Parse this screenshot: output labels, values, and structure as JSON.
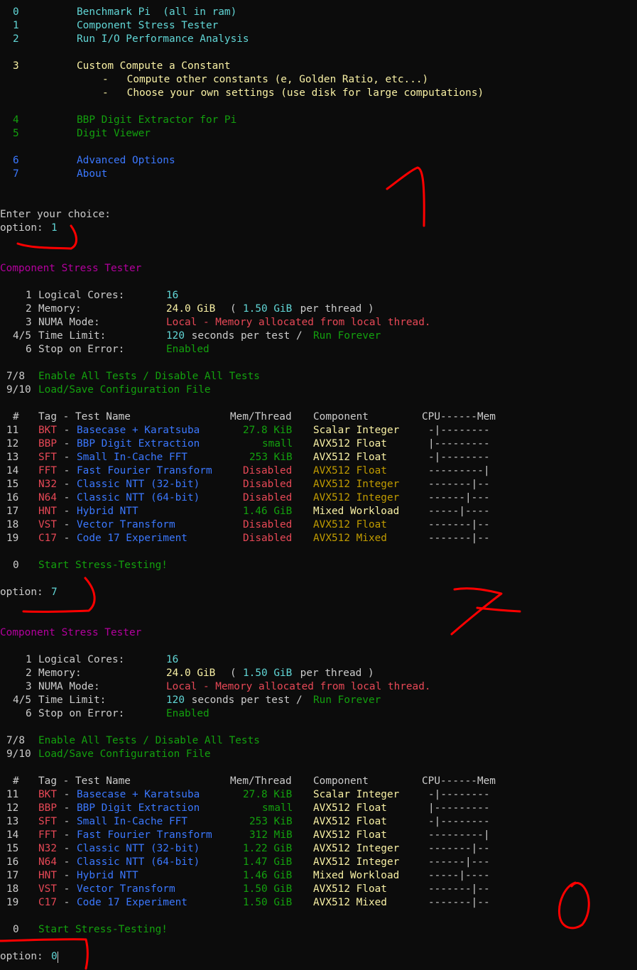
{
  "theme": {
    "bg": "#0c0c0c",
    "white": "#cccccc",
    "cyan": "#61d6d6",
    "yellow": "#f9f1a5",
    "green": "#13a10e",
    "blue": "#3b78ff",
    "magenta": "#b4009e",
    "red": "#e74856",
    "olive": "#c19c00",
    "ink": "#ff0000"
  },
  "main_menu": [
    {
      "num": "0",
      "label": "Benchmark Pi  (all in ram)",
      "color": "cyan"
    },
    {
      "num": "1",
      "label": "Component Stress Tester",
      "color": "cyan"
    },
    {
      "num": "2",
      "label": "Run I/O Performance Analysis",
      "color": "cyan"
    },
    {
      "num": "3",
      "label": "Custom Compute a Constant",
      "color": "yellow"
    },
    {
      "num": "4",
      "label": "BBP Digit Extractor for Pi",
      "color": "green"
    },
    {
      "num": "5",
      "label": "Digit Viewer",
      "color": "green"
    },
    {
      "num": "6",
      "label": "Advanced Options",
      "color": "blue"
    },
    {
      "num": "7",
      "label": "About",
      "color": "blue"
    }
  ],
  "custom_sub": [
    "-   Compute other constants (e, Golden Ratio, etc...)",
    "-   Choose your own settings (use disk for large computations)"
  ],
  "prompt": {
    "enter": "Enter your choice:",
    "option": "option: "
  },
  "inputs": [
    "1",
    "7",
    "0"
  ],
  "stress": {
    "title": "Component Stress Tester",
    "settings": [
      {
        "num": "1",
        "label": "Logical Cores:"
      },
      {
        "num": "2",
        "label": "Memory:"
      },
      {
        "num": "3",
        "label": "NUMA Mode:"
      },
      {
        "num": "4/5",
        "label": "Time Limit:"
      },
      {
        "num": "6",
        "label": "Stop on Error:"
      }
    ],
    "cores": "16",
    "mem_total": "24.0 GiB",
    "paren_open": "( ",
    "mem_thread": "1.50 GiB",
    "per_thread": " per thread )",
    "numa": "Local - Memory allocated from local thread.",
    "time_value": "120",
    "time_rest": " seconds per test / ",
    "run_forever": "Run Forever",
    "stop_value": "Enabled",
    "toggle_num": "7/8",
    "toggle_label": "Enable All Tests / Disable All Tests",
    "config_num": "9/10",
    "config_label": "Load/Save Configuration File",
    "headers": {
      "num": "#",
      "tag": "Tag - Test Name",
      "mem": "Mem/Thread",
      "component": "Component",
      "cpumem": "CPU------Mem"
    },
    "dash": " - ",
    "start_num": "0",
    "start_label": "Start Stress-Testing!"
  },
  "tests": [
    {
      "num": "11",
      "tag": "BKT",
      "name": "Basecase + Karatsuba",
      "component": "Scalar Integer",
      "bar": "-|--------"
    },
    {
      "num": "12",
      "tag": "BBP",
      "name": "BBP Digit Extraction",
      "component": "AVX512 Float",
      "bar": "|---------"
    },
    {
      "num": "13",
      "tag": "SFT",
      "name": "Small In-Cache FFT",
      "component": "AVX512 Float",
      "bar": "-|--------"
    },
    {
      "num": "14",
      "tag": "FFT",
      "name": "Fast Fourier Transform",
      "component": "AVX512 Float",
      "bar": "---------|"
    },
    {
      "num": "15",
      "tag": "N32",
      "name": "Classic NTT (32-bit)",
      "component": "AVX512 Integer",
      "bar": "-------|--"
    },
    {
      "num": "16",
      "tag": "N64",
      "name": "Classic NTT (64-bit)",
      "component": "AVX512 Integer",
      "bar": "------|---"
    },
    {
      "num": "17",
      "tag": "HNT",
      "name": "Hybrid NTT",
      "component": "Mixed Workload",
      "bar": "-----|----"
    },
    {
      "num": "18",
      "tag": "VST",
      "name": "Vector Transform",
      "component": "AVX512 Float",
      "bar": "-------|--"
    },
    {
      "num": "19",
      "tag": "C17",
      "name": "Code 17 Experiment",
      "component": "AVX512 Mixed",
      "bar": "-------|--"
    }
  ],
  "blocks": [
    {
      "mem": [
        "27.8 KiB",
        "small",
        "253 KiB",
        "Disabled",
        "Disabled",
        "Disabled",
        "1.46 GiB",
        "Disabled",
        "Disabled"
      ]
    },
    {
      "mem": [
        "27.8 KiB",
        "small",
        "253 KiB",
        "312 MiB",
        "1.22 GiB",
        "1.47 GiB",
        "1.46 GiB",
        "1.50 GiB",
        "1.50 GiB"
      ]
    }
  ],
  "annotations": [
    "1",
    "7",
    "0"
  ]
}
